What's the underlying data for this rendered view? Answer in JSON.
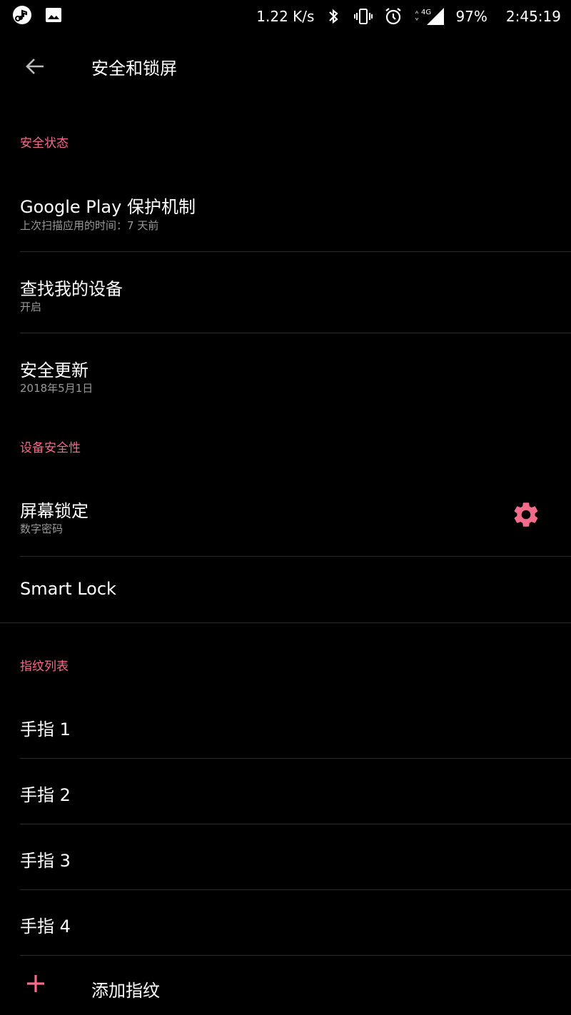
{
  "status_bar": {
    "net_speed": "1.22 K/s",
    "network_type": "4G",
    "battery": "97%",
    "time": "2:45:19",
    "icons": [
      "music-note-icon",
      "image-icon",
      "bluetooth-icon",
      "vibrate-icon",
      "alarm-icon",
      "signal-icon"
    ]
  },
  "app_bar": {
    "title": "安全和锁屏",
    "back_icon": "arrow-back-icon"
  },
  "sections": {
    "security_status": {
      "header": "安全状态",
      "items": [
        {
          "title": "Google Play 保护机制",
          "subtitle": "上次扫描应用的时间：7 天前"
        },
        {
          "title": "查找我的设备",
          "subtitle": "开启"
        },
        {
          "title": "安全更新",
          "subtitle": "2018年5月1日"
        }
      ]
    },
    "device_security": {
      "header": "设备安全性",
      "items": [
        {
          "title": "屏幕锁定",
          "subtitle": "数字密码",
          "action_icon": "gear-icon"
        },
        {
          "title": "Smart Lock"
        }
      ]
    },
    "fingerprints": {
      "header": "指纹列表",
      "items": [
        {
          "title": "手指 1"
        },
        {
          "title": "手指 2"
        },
        {
          "title": "手指 3"
        },
        {
          "title": "手指 4"
        }
      ],
      "add_label": "添加指纹",
      "add_icon": "plus-icon"
    }
  },
  "colors": {
    "accent": "#f36c8a",
    "background": "#000000",
    "divider": "#2b2b2b",
    "secondary_text": "#9a9a9a"
  }
}
